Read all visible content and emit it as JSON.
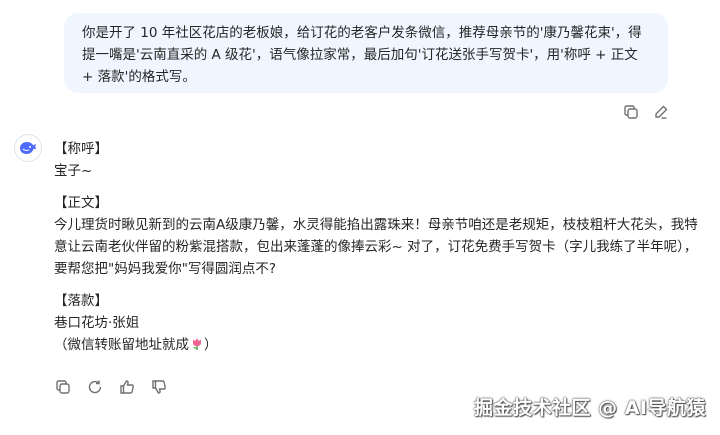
{
  "user_message": {
    "text": "你是开了 10 年社区花店的老板娘，给订花的老客户发条微信，推荐母亲节的'康乃馨花束'，得提一嘴是'云南直采的 A 级花'，语气像拉家常，最后加句'订花送张手写贺卡'，用'称呼 + 正文 + 落款'的格式写。"
  },
  "assistant_reply": {
    "salutation_heading": "【称呼】",
    "salutation": "宝子~",
    "body_heading": "【正文】",
    "body": "今儿理货时瞅见新到的云南A级康乃馨，水灵得能掐出露珠来！母亲节咱还是老规矩，枝枝粗杆大花头，我特意让云南老伙伴留的粉紫混搭款，包出来蓬蓬的像捧云彩~ 对了，订花免费手写贺卡（字儿我练了半年呢），要帮您把\"妈妈我爱你\"写得圆润点不?",
    "signature_heading": "【落款】",
    "signature": "巷口花坊·张姐",
    "signature_note_open": "（微信转账留地址就成",
    "signature_note_close": "）"
  },
  "icons": {
    "copy": "copy-icon",
    "edit": "edit-icon",
    "regenerate": "regenerate-icon",
    "like": "thumbs-up-icon",
    "dislike": "thumbs-down-icon",
    "flower": "tulip-icon",
    "avatar": "whale-logo-icon"
  },
  "colors": {
    "user_bubble": "#eff6ff",
    "brand": "#4d6bfe"
  },
  "watermark": "掘金技术社区 @ AI导航猿"
}
